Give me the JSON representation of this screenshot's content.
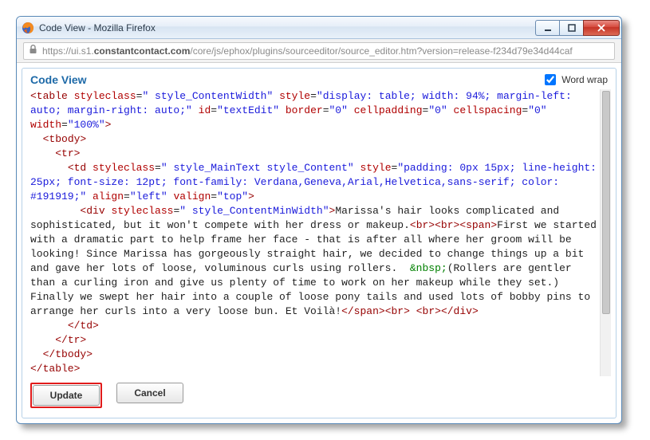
{
  "window": {
    "title": "Code View - Mozilla Firefox"
  },
  "address": {
    "scheme": "https://",
    "host_pre": "ui.s1.",
    "host_bold": "constantcontact.com",
    "path": "/core/js/ephox/plugins/sourceeditor/source_editor.htm?version=release-f234d79e34d44caf"
  },
  "panel": {
    "title": "Code View",
    "wordwrap_label": "Word wrap",
    "wordwrap_checked": true
  },
  "buttons": {
    "update": "Update",
    "cancel": "Cancel"
  },
  "code": {
    "open_table_1": "<table",
    "attr_styleclass": " styleclass",
    "val_style_ContentWidth": "\" style_ContentWidth\"",
    "attr_style": " style",
    "val_table_style": "\"display: table; width: 94%; margin-left: auto; margin-right: auto;\"",
    "attr_id": " id",
    "val_id": "\"textEdit\"",
    "attr_border": " border",
    "val_0": "\"0\"",
    "attr_cellpadding": " cellpadding",
    "attr_cellspacing": " cellspacing",
    "attr_width": " width",
    "val_100pct": "\"100%\"",
    "tbody_open": "<tbody>",
    "tr_open": "<tr>",
    "td_open": "<td",
    "val_td_styleclass": "\" style_MainText style_Content\"",
    "val_td_style": "\"padding: 0px 15px; line-height: 25px; font-size: 12pt; font-family: Verdana,Geneva,Arial,Helvetica,sans-serif; color: #191919;\"",
    "attr_align": " align",
    "val_left": "\"left\"",
    "attr_valign": " valign",
    "val_top": "\"top\"",
    "div_open": "<div",
    "val_div_styleclass": "\" style_ContentMinWidth\"",
    "body_text_1": "Marissa's hair looks complicated and sophisticated, but it won't compete with her dress or makeup.",
    "br": "<br>",
    "span_open": "<span>",
    "body_text_2": "First we started with a dramatic part to help frame her face - that is after all where her groom will be looking! Since Marissa has gorgeously straight hair, we decided to change things up a bit and gave her lots of loose, voluminous curls using rollers. ",
    "nbsp": " &nbsp;",
    "body_text_3": "(Rollers are gentler than a curling iron and give us plenty of time to work on her makeup while they set.) Finally we swept her hair into a couple of loose pony tails and used lots of bobby pins to arrange her curls into a very loose bun. Et Voilà!",
    "span_close": "</span>",
    "div_close": "</div>",
    "td_close": "</td>",
    "tr_close": "</tr>",
    "tbody_close": "</tbody>",
    "table_close": "</table>"
  }
}
